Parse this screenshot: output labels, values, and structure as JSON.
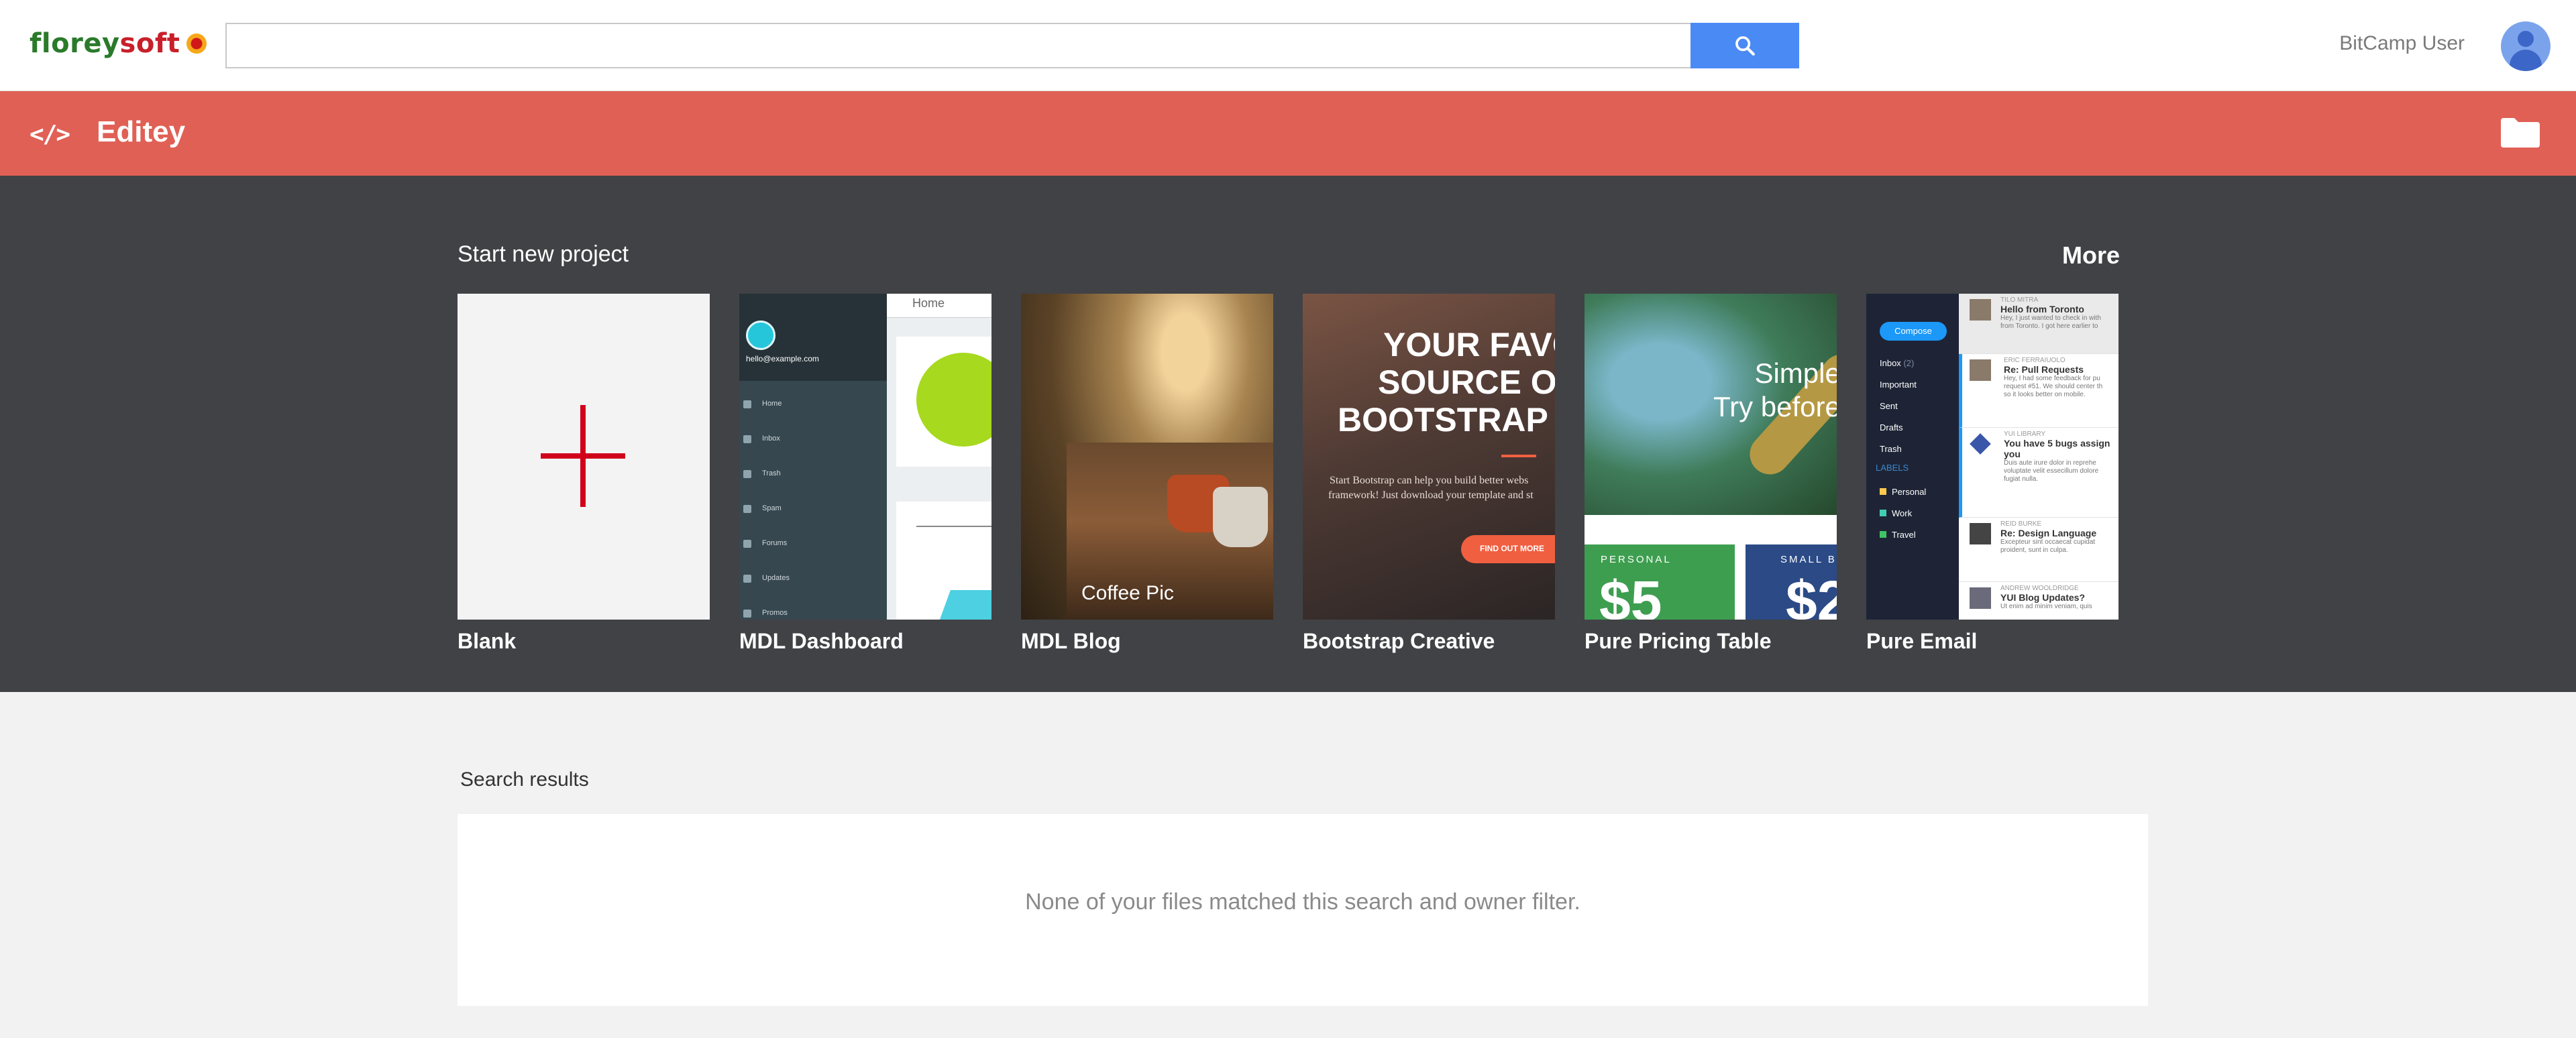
{
  "header": {
    "logo": {
      "part1": "florey",
      "part2": "soft"
    },
    "search": {
      "value": "",
      "placeholder": ""
    },
    "user": {
      "name": "BitCamp User"
    },
    "colors": {
      "search_button": "#4a8af4",
      "logo_green": "#2a7a2a",
      "logo_red": "#c8202a"
    },
    "icons": [
      "search-icon",
      "avatar-icon"
    ]
  },
  "appbar": {
    "icon": "</>",
    "title": "Editey",
    "color": "#e06055",
    "icons": [
      "code-icon",
      "folder-icon"
    ]
  },
  "templates": {
    "title": "Start new project",
    "more": "More",
    "items": [
      {
        "label": "Blank"
      },
      {
        "label": "MDL Dashboard"
      },
      {
        "label": "MDL Blog"
      },
      {
        "label": "Bootstrap Creative"
      },
      {
        "label": "Pure Pricing Table"
      },
      {
        "label": "Pure Email"
      }
    ],
    "thumbs": {
      "dashboard": {
        "email": "hello@example.com",
        "header": "Home",
        "nav": [
          "Home",
          "Inbox",
          "Trash",
          "Spam",
          "Forums",
          "Updates",
          "Promos"
        ]
      },
      "blog": {
        "caption": "Coffee Pic"
      },
      "creative": {
        "heading": [
          "YOUR FAVO",
          "SOURCE OF",
          "BOOTSTRAP T"
        ],
        "text": [
          "Start Bootstrap can help you build better webs",
          "framework! Just download your template and st"
        ],
        "button": "FIND OUT MORE"
      },
      "pricing": {
        "headline": [
          "Simple",
          "Try before"
        ],
        "plans": [
          {
            "name": "PERSONAL",
            "price": "$5"
          },
          {
            "name": "SMALL B",
            "price": "$2"
          }
        ]
      },
      "email": {
        "compose": "Compose",
        "nav": [
          {
            "name": "Inbox",
            "count": "(2)"
          },
          {
            "name": "Important",
            "count": ""
          },
          {
            "name": "Sent",
            "count": ""
          },
          {
            "name": "Drafts",
            "count": ""
          },
          {
            "name": "Trash",
            "count": ""
          }
        ],
        "labels_title": "LABELS",
        "labels": [
          {
            "name": "Personal",
            "color": "#ffc94c"
          },
          {
            "name": "Work",
            "color": "#41ccb4"
          },
          {
            "name": "Travel",
            "color": "#40c365"
          }
        ],
        "messages": [
          {
            "from": "TILO MITRA",
            "subject": "Hello from Toronto",
            "body": [
              "Hey, I just wanted to check in with",
              "from Toronto. I got here earlier to"
            ]
          },
          {
            "from": "ERIC FERRAIUOLO",
            "subject": "Re: Pull Requests",
            "body": [
              "Hey, I had some feedback for pu",
              "request #51. We should center th",
              "so it looks better on mobile."
            ]
          },
          {
            "from": "YUI LIBRARY",
            "subject": "You have 5 bugs assign",
            "subject2": "you",
            "body": [
              "Duis aute irure dolor in reprehe",
              "voluptate velit essecillum dolore",
              "fugiat nulla."
            ]
          },
          {
            "from": "REID BURKE",
            "subject": "Re: Design Language",
            "body": [
              "Excepteur sint occaecat cupidat",
              "proident, sunt in culpa."
            ]
          },
          {
            "from": "ANDREW WOOLDRIDGE",
            "subject": "YUI Blog Updates?",
            "body": [
              "Ut enim ad minim veniam, quis"
            ]
          }
        ]
      }
    }
  },
  "results": {
    "title": "Search results",
    "message": "None of your files matched this search and owner filter."
  }
}
